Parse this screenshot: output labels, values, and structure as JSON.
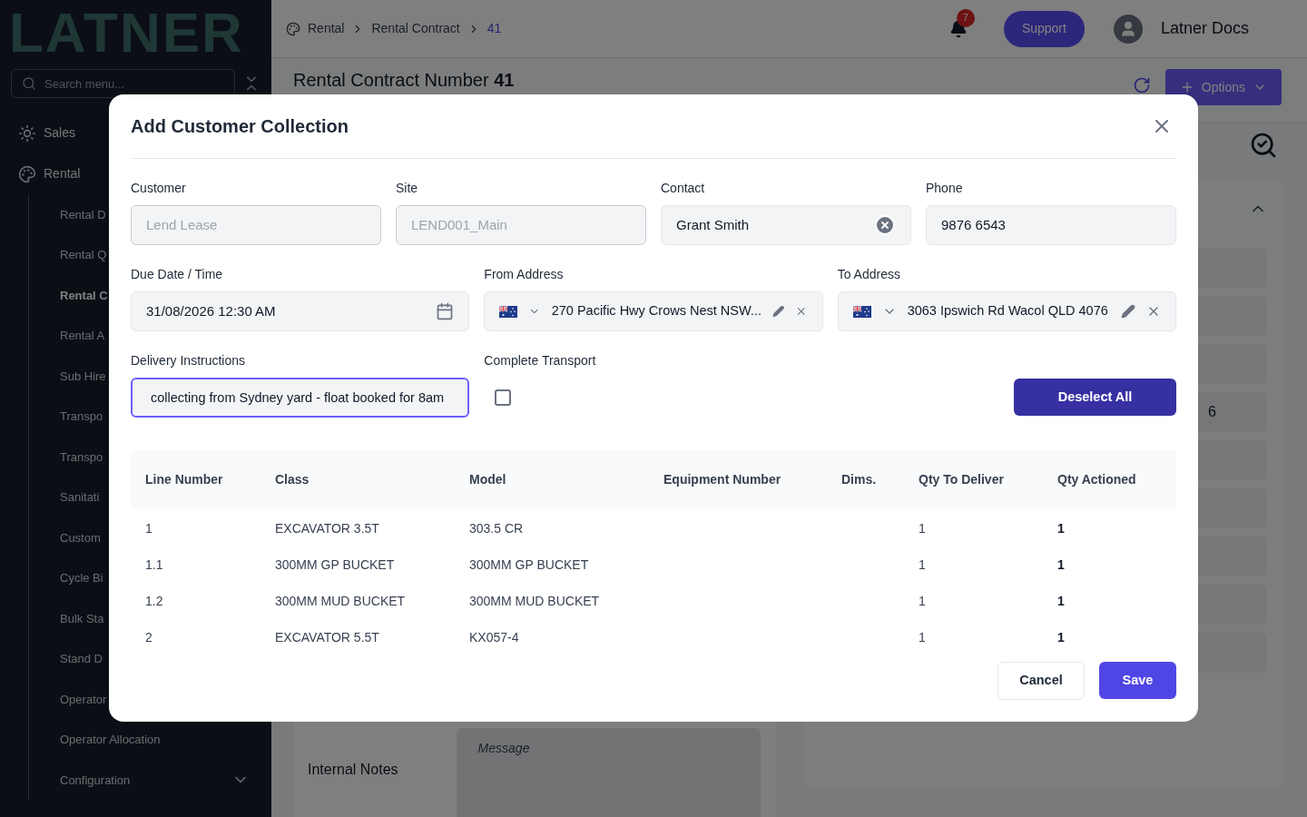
{
  "sidebar": {
    "logo": "LATNER",
    "search": {
      "placeholder": "Search menu..."
    },
    "items": [
      {
        "label": "Sales",
        "kind": "sales"
      },
      {
        "label": "Rental",
        "kind": "rental",
        "children": [
          {
            "label": "Rental D",
            "kind": "link",
            "selected": false
          },
          {
            "label": "Rental Q",
            "kind": "link",
            "selected": false
          },
          {
            "label": "Rental C",
            "kind": "link",
            "selected": true
          },
          {
            "label": "Rental A",
            "kind": "link",
            "selected": false
          },
          {
            "label": "Sub Hire",
            "kind": "link",
            "selected": false
          },
          {
            "label": "Transpo",
            "kind": "link",
            "selected": false
          },
          {
            "label": "Transpo",
            "kind": "link",
            "selected": false
          },
          {
            "label": "Sanitati",
            "kind": "link",
            "selected": false
          },
          {
            "label": "Custom",
            "kind": "link",
            "selected": false
          },
          {
            "label": "Cycle Bi",
            "kind": "link",
            "selected": false
          },
          {
            "label": "Bulk Sta",
            "kind": "link",
            "selected": false
          },
          {
            "label": "Stand D",
            "kind": "link",
            "selected": false
          },
          {
            "label": "Operator",
            "kind": "link",
            "selected": false
          },
          {
            "label": "Operator Allocation",
            "kind": "link",
            "selected": false
          },
          {
            "label": "Configuration",
            "kind": "group",
            "selected": false
          }
        ]
      }
    ]
  },
  "header": {
    "breadcrumbs": [
      {
        "label": "Rental",
        "current": false
      },
      {
        "label": "Rental Contract",
        "current": false
      },
      {
        "label": "41",
        "current": true
      }
    ],
    "notifications": "7",
    "support": "Support",
    "user": "Latner Docs"
  },
  "page": {
    "title": "Rental Contract Number",
    "number": "41",
    "options": "Options",
    "card_value": "6",
    "message_placeholder": "Message",
    "notes_label": "Internal Notes"
  },
  "modal": {
    "title": "Add Customer Collection",
    "row1": [
      {
        "label": "Customer",
        "kind": "text",
        "value": "Lend Lease",
        "disabled": true
      },
      {
        "label": "Site",
        "kind": "text",
        "value": "LEND001_Main",
        "disabled": true
      },
      {
        "label": "Contact",
        "kind": "clearable",
        "value": "Grant Smith",
        "disabled": false
      },
      {
        "label": "Phone",
        "kind": "text",
        "value": "9876 6543",
        "disabled": false
      }
    ],
    "row2": [
      {
        "label": "Due Date / Time",
        "kind": "date",
        "value": "31/08/2026 12:30 AM"
      },
      {
        "label": "From Address",
        "kind": "address",
        "value": "270 Pacific Hwy Crows Nest NSW..."
      },
      {
        "label": "To Address",
        "kind": "address",
        "value": "3063 Ipswich Rd Wacol QLD 4076"
      }
    ],
    "delivery_instructions": {
      "label": "Delivery Instructions",
      "value": "collecting from Sydney yard - float booked for 8am",
      "focused": true
    },
    "complete_transport": {
      "label": "Complete Transport",
      "checked": false
    },
    "deselect_all": "Deselect All",
    "table": {
      "columns": [
        "Line Number",
        "Class",
        "Model",
        "Equipment Number",
        "Dims.",
        "Qty To Deliver",
        "Qty Actioned"
      ],
      "rows": [
        [
          "1",
          "EXCAVATOR 3.5T",
          "303.5 CR",
          "",
          "",
          "1",
          "1"
        ],
        [
          "1.1",
          "300MM GP BUCKET",
          "300MM GP BUCKET",
          "",
          "",
          "1",
          "1"
        ],
        [
          "1.2",
          "300MM MUD BUCKET",
          "300MM MUD BUCKET",
          "",
          "",
          "1",
          "1"
        ],
        [
          "2",
          "EXCAVATOR 5.5T",
          "KX057-4",
          "",
          "",
          "1",
          "1"
        ]
      ]
    },
    "cancel": "Cancel",
    "save": "Save"
  }
}
